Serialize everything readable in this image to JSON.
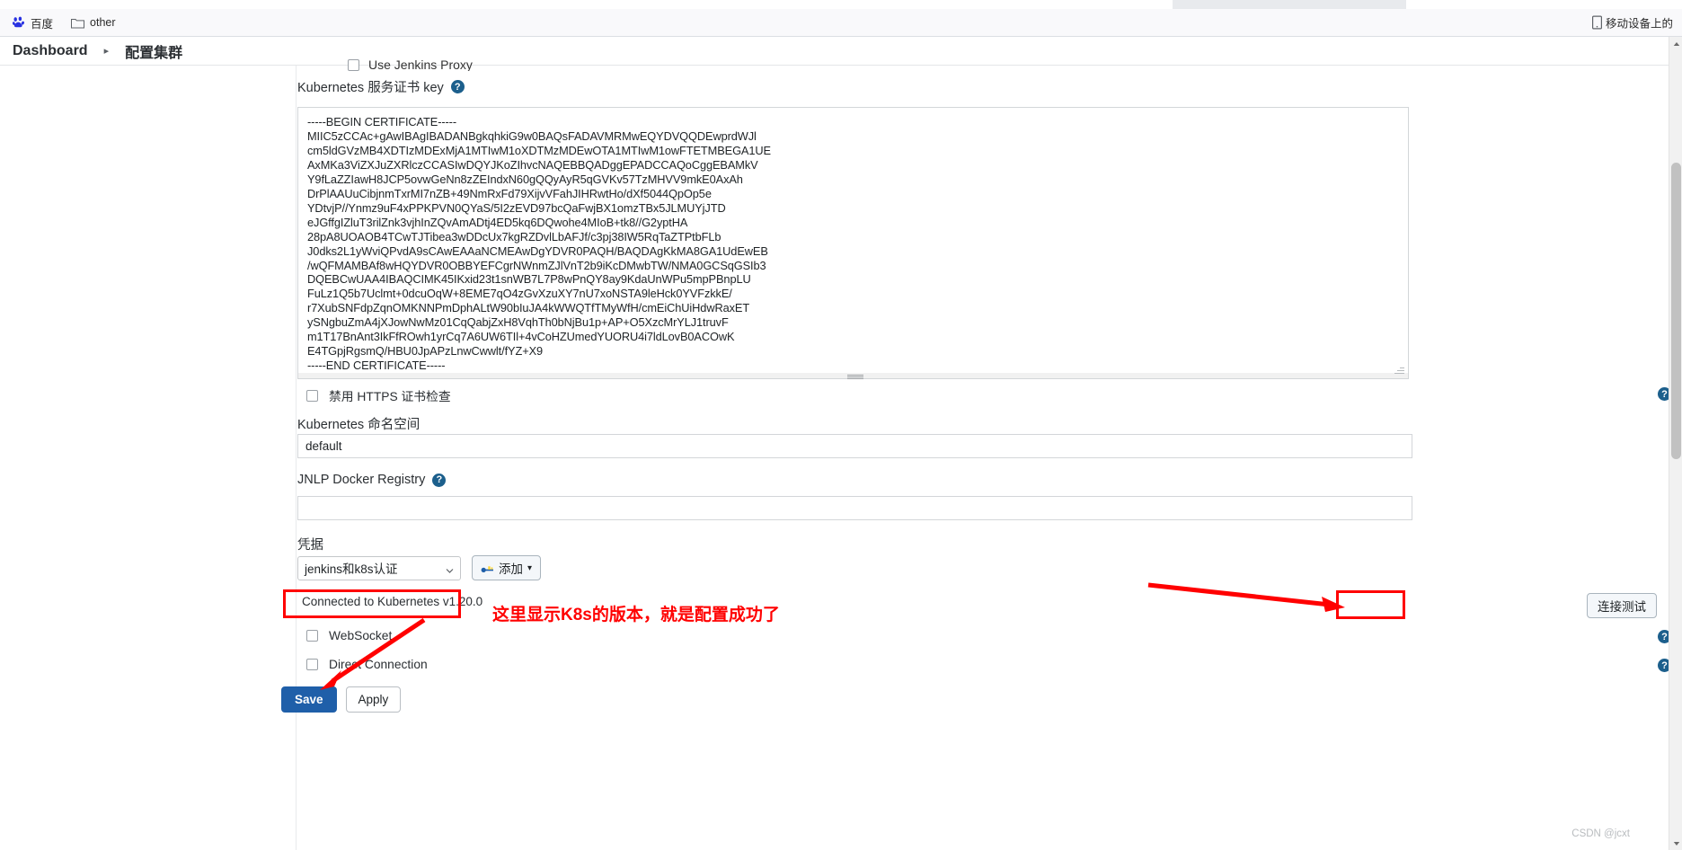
{
  "browser": {
    "bookmarks": [
      {
        "icon": "baidu-icon",
        "label": "百度"
      },
      {
        "icon": "folder-icon",
        "label": "other"
      }
    ],
    "right_bookmark": {
      "icon": "mobile-device-icon",
      "label": "移动设备上的"
    }
  },
  "breadcrumb": {
    "root": "Dashboard",
    "separator": "▸",
    "current": "配置集群"
  },
  "form": {
    "clipped_checkbox_label": "Use Jenkins Proxy",
    "cert_label": "Kubernetes 服务证书 key",
    "help_glyph": "?",
    "certificate": "-----BEGIN CERTIFICATE-----\nMIIC5zCCAc+gAwIBAgIBADANBgkqhkiG9w0BAQsFADAVMRMwEQYDVQQDEwprdWJl\ncm5ldGVzMB4XDTIzMDExMjA1MTIwM1oXDTMzMDEwOTA1MTIwM1owFTETMBEGA1UE\nAxMKa3ViZXJuZXRlczCCASIwDQYJKoZIhvcNAQEBBQADggEPADCCAQoCggEBAMkV\nY9fLaZZIawH8JCP5ovwGeNn8zZEIndxN60gQQyAyR5qGVKv57TzMHVV9mkE0AxAh\nDrPlAAUuCibjnmTxrMI7nZB+49NmRxFd79XijvVFahJIHRwtHo/dXf5044QpOp5e\nYDtvjP//Ynmz9uF4xPPKPVN0QYaS/5I2zEVD97bcQaFwjBX1omzTBx5JLMUYjJTD\neJGffgIZluT3rilZnk3vjhInZQvAmADtj4ED5kq6DQwohe4MIoB+tk8//G2yptHA\n28pA8UOAOB4TCwTJTibea3wDDcUx7kgRZDvlLbAFJf/c3pj38IW5RqTaZTPtbFLb\nJ0dks2L1yWviQPvdA9sCAwEAAaNCMEAwDgYDVR0PAQH/BAQDAgKkMA8GA1UdEwEB\n/wQFMAMBAf8wHQYDVR0OBBYEFCgrNWnmZJlVnT2b9iKcDMwbTW/NMA0GCSqGSIb3\nDQEBCwUAA4IBAQCIMK45IKxid23t1snWB7L7P8wPnQY8ay9KdaUnWPu5mpPBnpLU\nFuLz1Q5b7Uclmt+0dcuOqW+8EME7qO4zGvXzuXY7nU7xoNSTA9leHck0YVFzkkE/\nr7XubSNFdpZqnOMKNNPmDphALtW90bIuJA4kWWQTfTMyWfH/cmEiChUiHdwRaxET\nySNgbuZmA4jXJowNwMz01CqQabjZxH8VqhTh0bNjBu1p+AP+O5XzcMrYLJ1truvF\nm1T17BnAnt3IkFfROwh1yrCq7A6UW6TIl+4vCoHZUmedYUORU4i7ldLovB0ACOwK\nE4TGpjRgsmQ/HBU0JpAPzLnwCwwlt/fYZ+X9\n-----END CERTIFICATE-----",
    "disable_https_check_label": "禁用 HTTPS 证书检查",
    "namespace_label": "Kubernetes 命名空间",
    "namespace_value": "default",
    "jnlp_registry_label": "JNLP Docker Registry",
    "jnlp_registry_value": "",
    "credentials_label": "凭据",
    "credentials_selected": "jenkins和k8s认证",
    "add_button_label": "添加",
    "add_button_caret": "▾",
    "connection_status": "Connected to Kubernetes v1.20.0",
    "websocket_label": "WebSocket",
    "direct_connection_label": "Direct Connection",
    "test_connection_label": "连接测试",
    "save_label": "Save",
    "apply_label": "Apply"
  },
  "annotations": {
    "note_text": "这里显示K8s的版本，就是配置成功了",
    "highlight_color": "#ff0000"
  },
  "watermark": "CSDN @jcxt"
}
